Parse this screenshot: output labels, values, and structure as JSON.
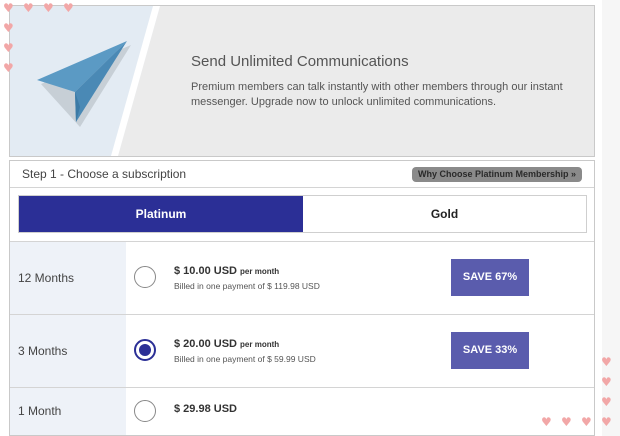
{
  "hero": {
    "title": "Send Unlimited Communications",
    "description": "Premium members can talk instantly with other members through our instant messenger. Upgrade now to unlock unlimited communications."
  },
  "subscription": {
    "step_title": "Step 1 - Choose a subscription",
    "why_button": "Why Choose Platinum Membership »",
    "tabs": [
      {
        "label": "Platinum",
        "active": true
      },
      {
        "label": "Gold",
        "active": false
      }
    ],
    "plans": [
      {
        "duration": "12 Months",
        "price": "$ 10.00 USD",
        "per": "per month",
        "billed": "Billed in one payment of $ 119.98 USD",
        "save": "SAVE 67%",
        "selected": false
      },
      {
        "duration": "3 Months",
        "price": "$ 20.00 USD",
        "per": "per month",
        "billed": "Billed in one payment of $ 59.99 USD",
        "save": "SAVE 33%",
        "selected": true
      },
      {
        "duration": "1 Month",
        "price": "$ 29.98 USD",
        "per": "",
        "billed": "",
        "save": "",
        "selected": false
      }
    ]
  },
  "colors": {
    "accent": "#2b2f96",
    "save_badge": "#5a5cad",
    "plane": "#5b9ac4",
    "hearts": "#f2a7a7"
  },
  "decor": {
    "heart_icon": "♥"
  }
}
